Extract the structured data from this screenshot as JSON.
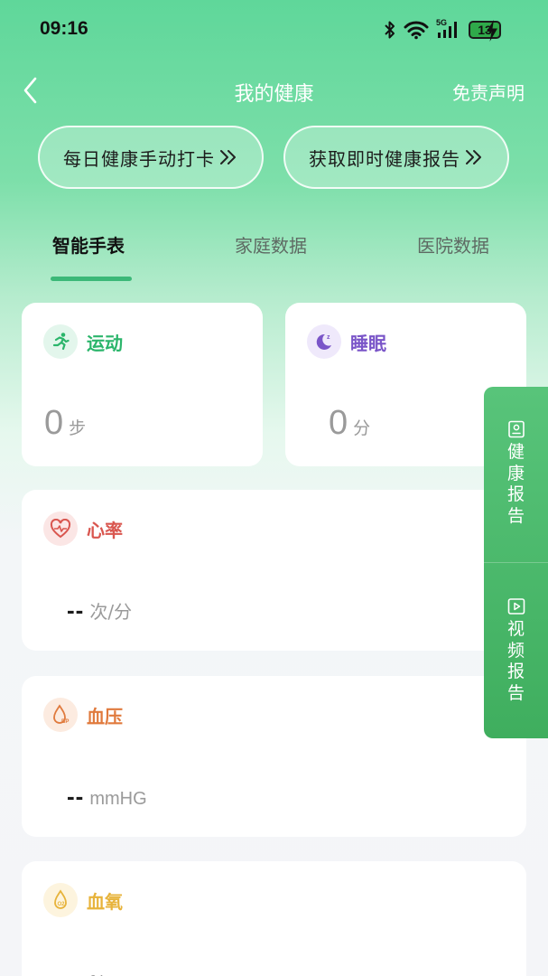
{
  "status_bar": {
    "time": "09:16",
    "network": "5G",
    "battery": "13"
  },
  "header": {
    "title": "我的健康",
    "disclaimer": "免责声明"
  },
  "actions": [
    {
      "label": "每日健康手动打卡"
    },
    {
      "label": "获取即时健康报告"
    }
  ],
  "tabs": [
    {
      "label": "智能手表",
      "active": true
    },
    {
      "label": "家庭数据",
      "active": false
    },
    {
      "label": "医院数据",
      "active": false
    }
  ],
  "cards": {
    "sport": {
      "label": "运动",
      "value": "0",
      "unit": "步",
      "color": "#2bb56b"
    },
    "sleep": {
      "label": "睡眠",
      "value": "0",
      "unit": "分",
      "color": "#7a55c8"
    },
    "heart_rate": {
      "label": "心率",
      "value": "--",
      "unit": "次/分",
      "color": "#d9564f"
    },
    "blood_pressure": {
      "label": "血压",
      "value": "--",
      "unit": "mmHG",
      "color": "#e07a3d"
    },
    "blood_oxygen": {
      "label": "血氧",
      "value": "--",
      "unit": "%",
      "color": "#e7b33b"
    }
  },
  "side_panel": [
    {
      "label": "健康报告",
      "icon": "report-icon"
    },
    {
      "label": "视频报告",
      "icon": "video-icon"
    }
  ]
}
